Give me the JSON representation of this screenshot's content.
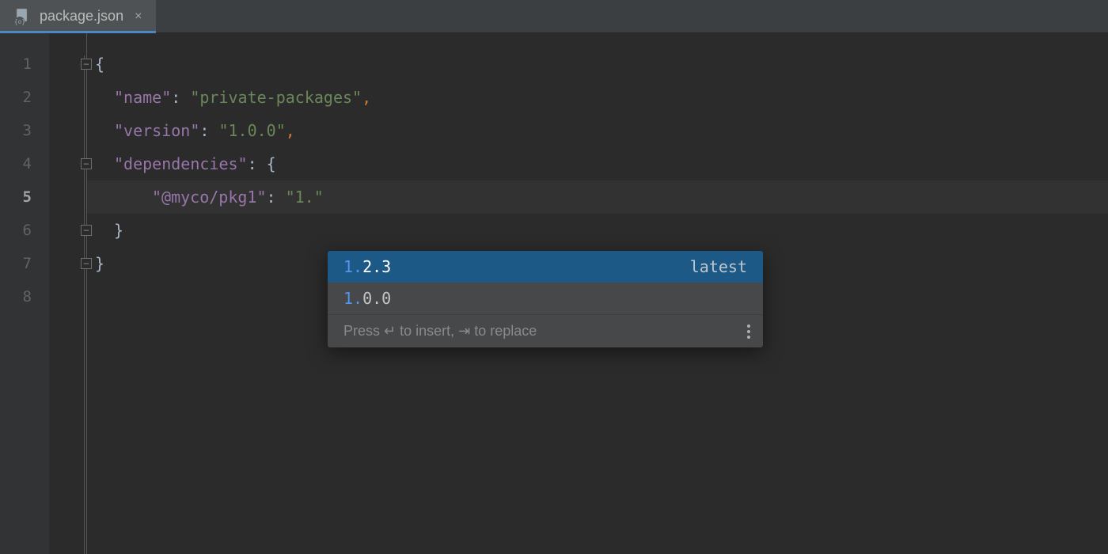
{
  "tab": {
    "filename": "package.json",
    "close_glyph": "×"
  },
  "code": {
    "lines": [
      "1",
      "2",
      "3",
      "4",
      "5",
      "6",
      "7",
      "8"
    ],
    "active_line": "5",
    "keys": {
      "name": "\"name\"",
      "version": "\"version\"",
      "dependencies": "\"dependencies\"",
      "pkg": "\"@myco/pkg1\""
    },
    "values": {
      "name": "\"private-packages\"",
      "version": "\"1.0.0\"",
      "pkg": "\"1.\""
    },
    "colon": ": ",
    "comma": ",",
    "open_brace": "{",
    "close_brace": "}"
  },
  "completion": {
    "items": [
      {
        "match": "1.",
        "rest": "2.3",
        "tag": "latest",
        "selected": true
      },
      {
        "match": "1.",
        "rest": "0.0",
        "tag": "",
        "selected": false
      }
    ],
    "footer_pre": "Press ",
    "footer_enter": "↵",
    "footer_mid": " to insert, ",
    "footer_tab": "⇥",
    "footer_post": " to replace"
  }
}
